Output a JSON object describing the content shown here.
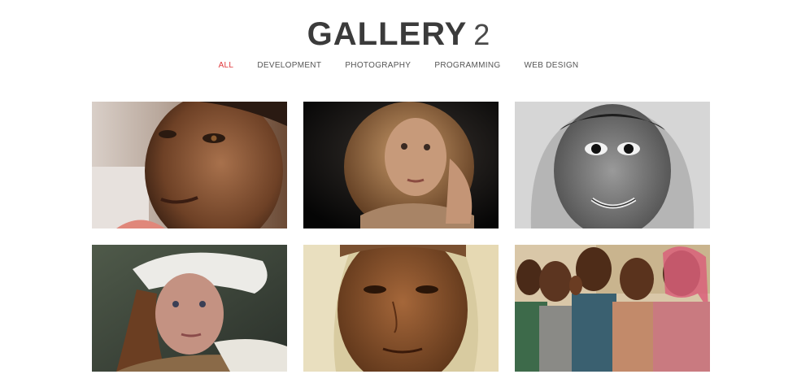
{
  "header": {
    "title": "GALLERY",
    "title_suffix": "2"
  },
  "filters": [
    {
      "label": "ALL",
      "active": true
    },
    {
      "label": "DEVELOPMENT",
      "active": false
    },
    {
      "label": "PHOTOGRAPHY",
      "active": false
    },
    {
      "label": "PROGRAMMING",
      "active": false
    },
    {
      "label": "WEB DESIGN",
      "active": false
    }
  ],
  "colors": {
    "accent": "#e0373a",
    "title": "#3b3b3b",
    "filter_text": "#555555"
  },
  "gallery": {
    "items": [
      {
        "subject": "portrait-girl-profile"
      },
      {
        "subject": "portrait-girl-dark-background"
      },
      {
        "subject": "portrait-child-hood-bw"
      },
      {
        "subject": "portrait-girl-headscarf"
      },
      {
        "subject": "portrait-woman-shawl"
      },
      {
        "subject": "group-children-waving"
      }
    ]
  }
}
